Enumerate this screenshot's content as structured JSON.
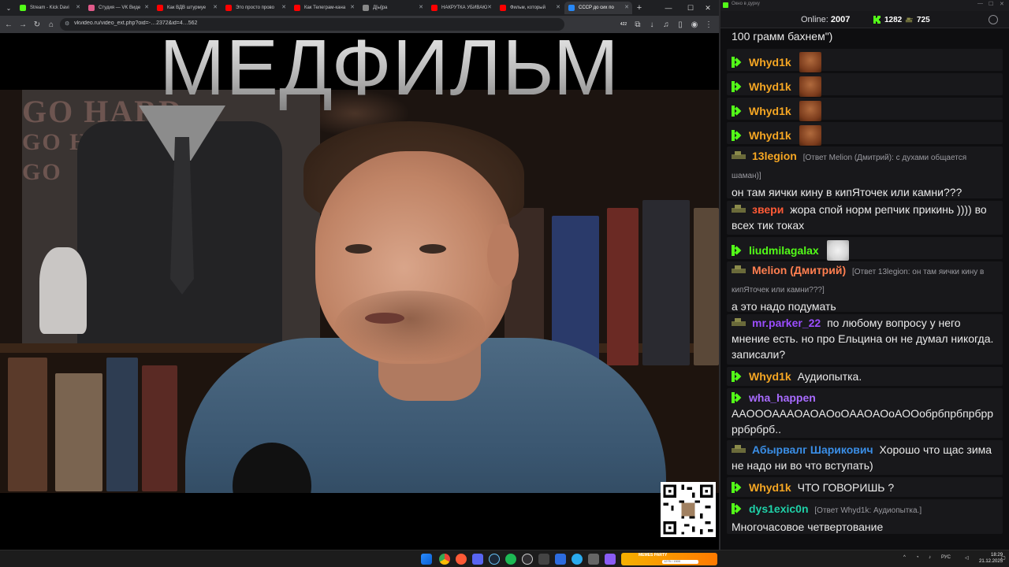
{
  "browser": {
    "tabs": [
      {
        "label": "Stream - Kick Davi",
        "favicon_color": "#53fc18"
      },
      {
        "label": "Студия — VK Виде",
        "favicon_color": "#e05a8a"
      },
      {
        "label": "Как ВДВ штурмуе",
        "favicon_color": "#ff0000"
      },
      {
        "label": "Это просто прово",
        "favicon_color": "#ff0000"
      },
      {
        "label": "Как Телеграм-кана",
        "favicon_color": "#ff0000"
      },
      {
        "label": "Д[ы]ра",
        "favicon_color": "#888888"
      },
      {
        "label": "НАКРУТКА УБИВАЮ",
        "favicon_color": "#ff0000"
      },
      {
        "label": "Фильм, который",
        "favicon_color": "#ff0000"
      },
      {
        "label": "СССР до сих по",
        "favicon_color": "#2787f5"
      }
    ],
    "url": "vkvideo.ru/video_ext.php?oid=-…2372&id=4…562",
    "badge_count": "422"
  },
  "video": {
    "watermark": "МЕДФИЛЬМ"
  },
  "chat_window": {
    "title": "Окно в дурку",
    "online_label": "Online:",
    "online_count": "2007",
    "stat_kick": "1282",
    "stat_tank": "725",
    "messages": [
      {
        "badge": "",
        "user": "",
        "user_color": "#eaeaea",
        "reply": "",
        "text": "100 грамм бахнем\")",
        "emote": ""
      },
      {
        "badge": "kick",
        "user": "Whyd1k",
        "user_color": "#f5a623",
        "reply": "",
        "text": "",
        "emote": "face"
      },
      {
        "badge": "kick",
        "user": "Whyd1k",
        "user_color": "#f5a623",
        "reply": "",
        "text": "",
        "emote": "face"
      },
      {
        "badge": "kick",
        "user": "Whyd1k",
        "user_color": "#f5a623",
        "reply": "",
        "text": "",
        "emote": "face"
      },
      {
        "badge": "kick",
        "user": "Whyd1k",
        "user_color": "#f5a623",
        "reply": "",
        "text": "",
        "emote": "face"
      },
      {
        "badge": "tank",
        "user": "13legion",
        "user_color": "#f5a623",
        "reply": "[Ответ Melion (Дмитрий): с духами общается шаман)]",
        "text": "он там яички кину в кипЯточек   или камни???",
        "emote": ""
      },
      {
        "badge": "tank",
        "user": "звери",
        "user_color": "#ff5a36",
        "reply": "",
        "text": "жора спой норм репчик прикинь )))) во всех тик токах",
        "emote": ""
      },
      {
        "badge": "kick",
        "user": "liudmilagalax",
        "user_color": "#53fc18",
        "reply": "",
        "text": "",
        "emote": "cat"
      },
      {
        "badge": "tank",
        "user": "Melion (Дмитрий)",
        "user_color": "#ff7f50",
        "reply": "[Ответ 13legion: он там яички кину в кипЯточек   или камни???]",
        "text": "а это надо подумать",
        "emote": ""
      },
      {
        "badge": "tank",
        "user": "mr.parker_22",
        "user_color": "#9b4dff",
        "reply": "",
        "text": "по любому вопросу у него мнение есть. но про Ельцина он не думал никогда. записали?",
        "emote": ""
      },
      {
        "badge": "kick",
        "user": "Whyd1k",
        "user_color": "#f5a623",
        "reply": "",
        "text": "Аудиопытка.",
        "emote": ""
      },
      {
        "badge": "kick",
        "user": "wha_happen",
        "user_color": "#a86bff",
        "reply": "",
        "text": "АAOOOAAAOAOAOoOAAOAOoAOOобрбпрбпрбррррбрбрб..",
        "emote": ""
      },
      {
        "badge": "tank",
        "user": "Абырвалг Шарикович",
        "user_color": "#3a8ee6",
        "reply": "",
        "text": "Хорошо что щас зима не надо ни во что вступать)",
        "emote": ""
      },
      {
        "badge": "kick",
        "user": "Whyd1k",
        "user_color": "#f5a623",
        "reply": "",
        "text": "ЧТО ГОВОРИШЬ ?",
        "emote": ""
      },
      {
        "badge": "kick",
        "user": "dys1exic0n",
        "user_color": "#1fd1a8",
        "reply": "[Ответ Whyd1k: Аудиопытка.]",
        "text": "Многочасовое четвертование",
        "emote": ""
      }
    ]
  },
  "taskbar": {
    "widget_title": "MEMES PARTY",
    "widget_counter": "1275 / 1500",
    "lang": "РУС",
    "time": "18:29",
    "date": "21.12.2025"
  }
}
